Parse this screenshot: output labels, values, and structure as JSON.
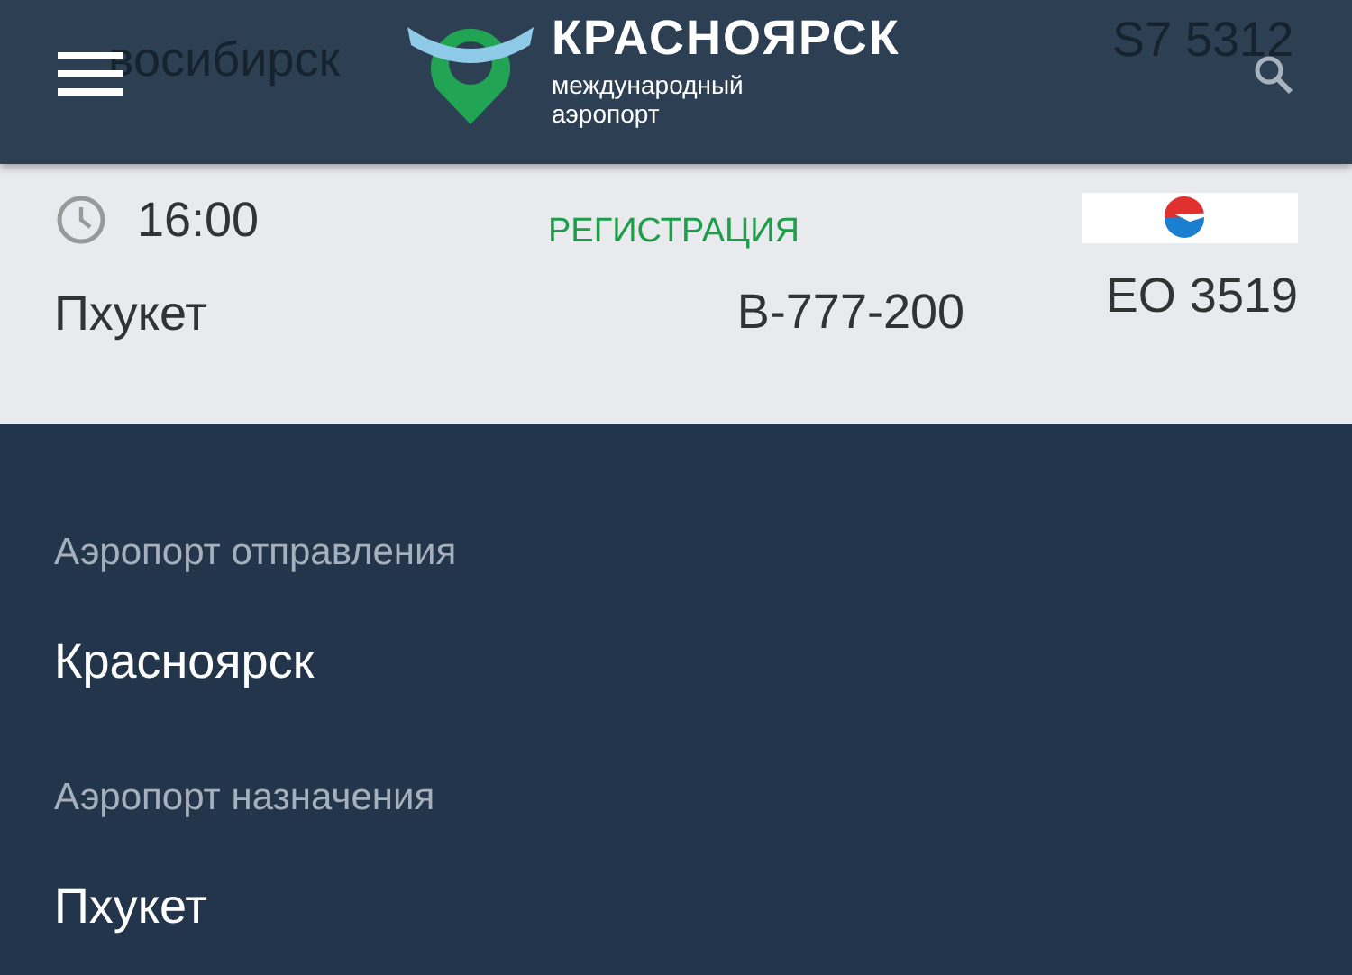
{
  "header": {
    "logo_title": "КРАСНОЯРСК",
    "logo_subtitle": "международный аэропорт",
    "behind": {
      "city": "восибирск",
      "flight": "S7 5312"
    }
  },
  "flight": {
    "time": "16:00",
    "status": "РЕГИСТРАЦИЯ",
    "destination": "Пхукет",
    "aircraft": "B-777-200",
    "number": "EO 3519"
  },
  "details": [
    {
      "label": "Аэропорт отправления",
      "value": "Красноярск"
    },
    {
      "label": "Аэропорт назначения",
      "value": "Пхукет"
    }
  ]
}
